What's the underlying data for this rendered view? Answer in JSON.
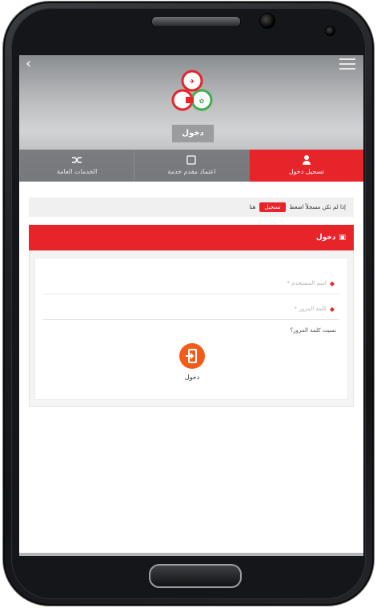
{
  "header": {
    "back_icon": "chevron-left-icon",
    "menu_icon": "hamburger-menu-icon",
    "login_button": "دخول"
  },
  "tabs": [
    {
      "label": "تسجيل دخول",
      "icon": "user-icon",
      "active": true
    },
    {
      "label": "اعتماد مقدم خدمة",
      "icon": "id-card-icon",
      "active": false
    },
    {
      "label": "الخدمات العامة",
      "icon": "shuffle-icon",
      "active": false
    }
  ],
  "notice": {
    "text": "إذا لم تكن مسجلاً اضغط",
    "register_label": "تسجيل",
    "suffix": "هنا"
  },
  "login_card": {
    "title": "دخول",
    "username_placeholder": "* اسم المستخدم",
    "password_placeholder": "* كلمة المرور",
    "forgot_link": "نسيت كلمة المرور؟",
    "submit_label": "دخول"
  },
  "colors": {
    "accent_red": "#e8242b",
    "login_orange": "#f25c18"
  }
}
